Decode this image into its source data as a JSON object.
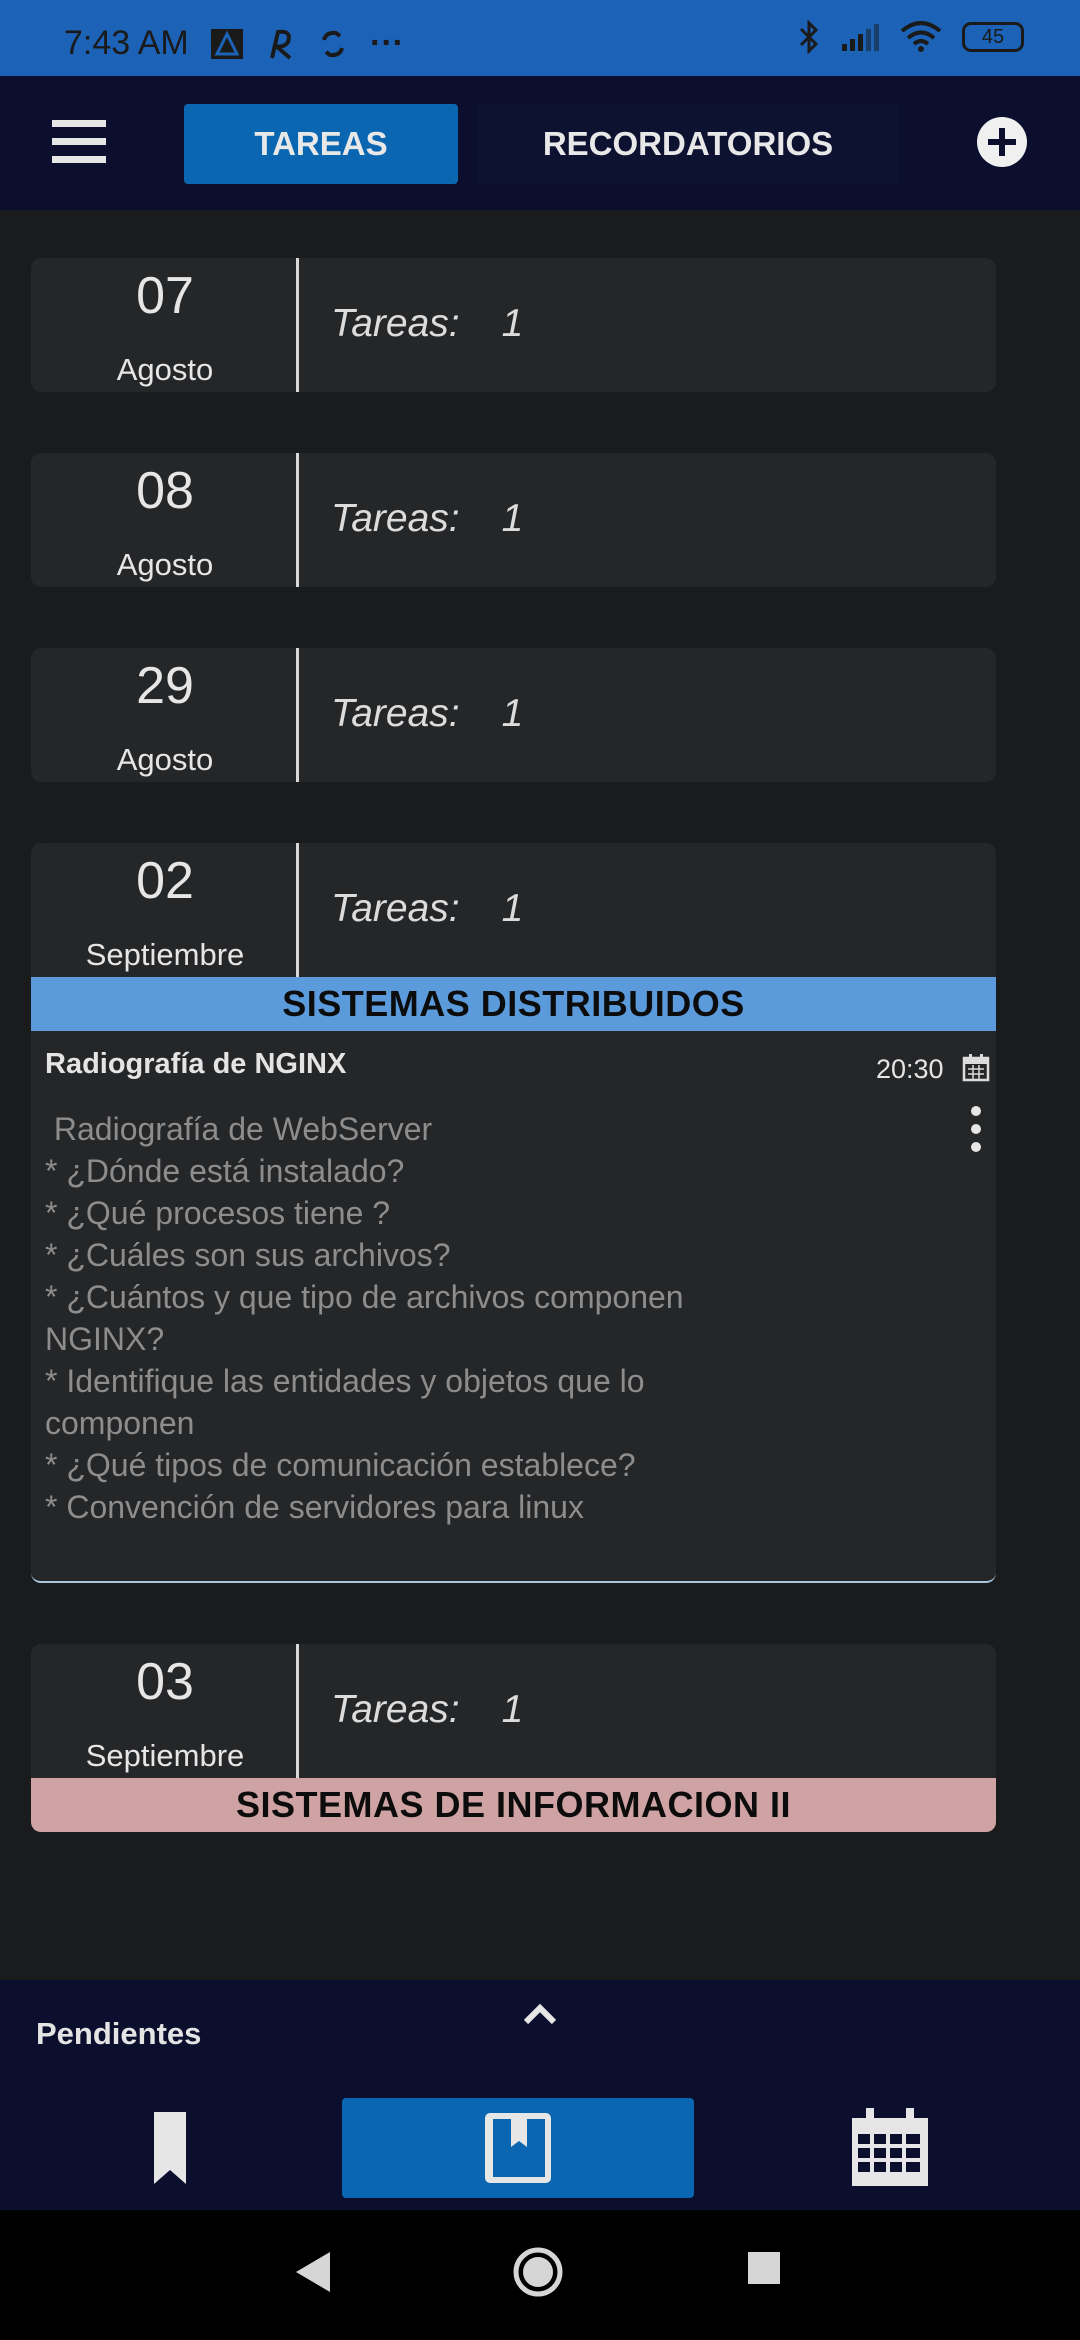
{
  "status_bar": {
    "time": "7:43 AM",
    "more": "···",
    "battery": "45"
  },
  "tabs": [
    {
      "label": "TAREAS",
      "active": true
    },
    {
      "label": "RECORDATORIOS",
      "active": false
    }
  ],
  "days": [
    {
      "day": "07",
      "month": "Agosto",
      "tasks_label": "Tareas:",
      "tasks_count": "1"
    },
    {
      "day": "08",
      "month": "Agosto",
      "tasks_label": "Tareas:",
      "tasks_count": "1"
    },
    {
      "day": "29",
      "month": "Agosto",
      "tasks_label": "Tareas:",
      "tasks_count": "1"
    },
    {
      "day": "02",
      "month": "Septiembre",
      "tasks_label": "Tareas:",
      "tasks_count": "1",
      "subject": "SISTEMAS DISTRIBUIDOS",
      "subject_color": "#5b9bdc",
      "task": {
        "title": "Radiografía de NGINX",
        "time": "20:30",
        "description": [
          " Radiografía de WebServer",
          "* ¿Dónde está instalado?",
          "* ¿Qué procesos tiene ?",
          "* ¿Cuáles son sus archivos?",
          "* ¿Cuántos y que tipo de archivos componen",
          "NGINX?",
          "* Identifique las entidades y objetos que lo",
          "componen",
          "* ¿Qué tipos de comunicación establece?",
          "* Convención de servidores para linux"
        ]
      }
    },
    {
      "day": "03",
      "month": "Septiembre",
      "tasks_label": "Tareas:",
      "tasks_count": "1",
      "subject": "SISTEMAS DE INFORMACION II",
      "subject_color": "#cfa3a3"
    }
  ],
  "bottom": {
    "pendientes": "Pendientes"
  },
  "colors": {
    "accent": "#0a66b0",
    "app_bar": "#0b0f2d",
    "status_bar": "#1c63b8",
    "card": "#252628"
  },
  "icons": [
    "menu-icon",
    "add-circle-icon",
    "calendar-icon",
    "kebab-menu-icon",
    "chevron-up-icon",
    "bookmark-icon",
    "book-icon",
    "calendar-grid-icon",
    "back-icon",
    "home-icon",
    "recents-icon"
  ]
}
